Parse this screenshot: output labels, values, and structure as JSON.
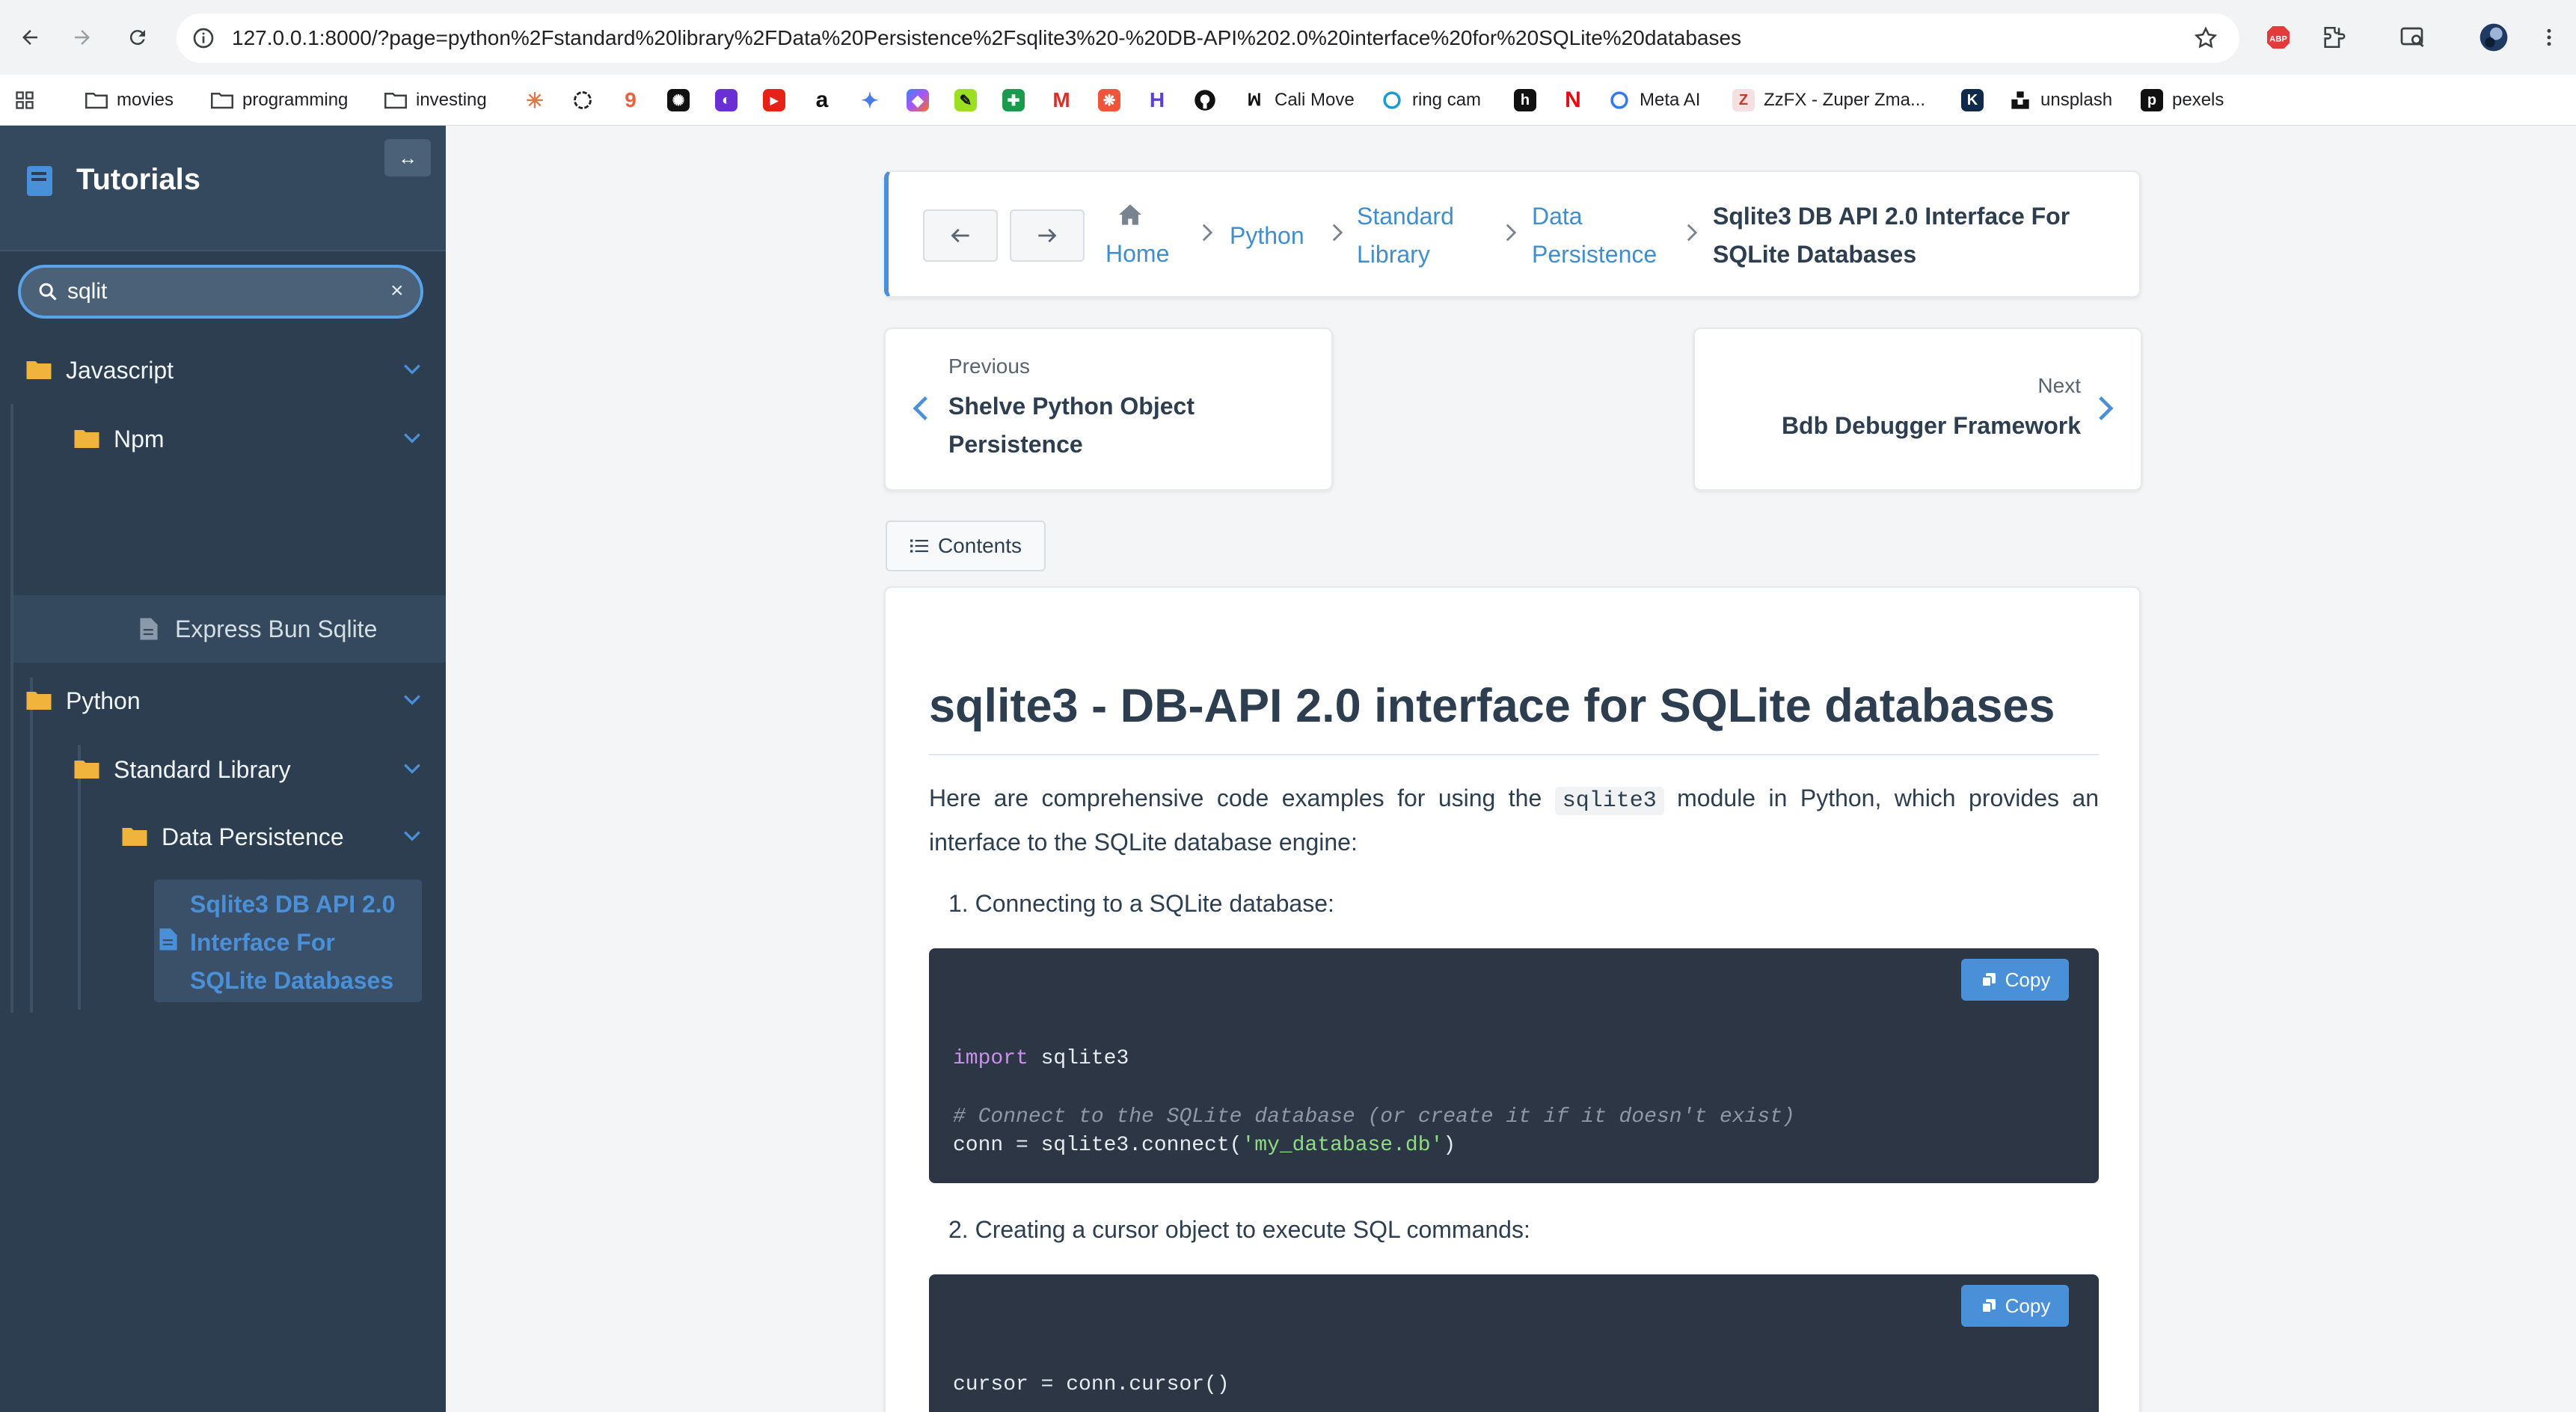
{
  "browser": {
    "url": "127.0.0.1:8000/?page=python%2Fstandard%20library%2FData%20Persistence%2Fsqlite3%20-%20DB-API%202.0%20interface%20for%20SQLite%20databases",
    "bookmarks": {
      "movies": "movies",
      "programming": "programming",
      "investing": "investing",
      "cali_move": "Cali Move",
      "ring_cam": "ring cam",
      "meta_ai": "Meta AI",
      "zzfx": "ZzFX - Zuper Zma...",
      "unsplash": "unsplash",
      "pexels": "pexels"
    }
  },
  "sidebar": {
    "title": "Tutorials",
    "toggle_label": "↔",
    "search": {
      "value": "sqlit",
      "clear": "×"
    },
    "tree": {
      "javascript": "Javascript",
      "npm": "Npm",
      "express": "Express Bun Sqlite",
      "python": "Python",
      "standard_library": "Standard Library",
      "data_persistence": "Data Persistence",
      "active_page": "Sqlite3 DB API 2.0 Interface For SQLite Databases"
    }
  },
  "breadcrumb": {
    "home": "Home",
    "python": "Python",
    "standard_library": "Standard Library",
    "data_persistence": "Data Persistence",
    "current": "Sqlite3 DB API 2.0 Interface For SQLite Databases"
  },
  "pager": {
    "previous_kicker": "Previous",
    "previous_title": "Shelve Python Object Persistence",
    "next_kicker": "Next",
    "next_title": "Bdb Debugger Framework"
  },
  "contents_label": "Contents",
  "article": {
    "title": "sqlite3 - DB-API 2.0 interface for SQLite databases",
    "intro_before": "Here are comprehensive code examples for using the ",
    "intro_code": "sqlite3",
    "intro_after": " module in Python, which provides an interface to the SQLite database engine:",
    "step1": "1. Connecting to a SQLite database:",
    "step2": "2. Creating a cursor object to execute SQL commands:",
    "copy_label": "Copy",
    "code1": {
      "import_kw": "import",
      "import_mod": " sqlite3",
      "comment": "# Connect to the SQLite database (or create it if it doesn't exist)",
      "conn_prefix": "conn = sqlite3.connect(",
      "conn_arg": "'my_database.db'",
      "conn_suffix": ")"
    },
    "code2": {
      "line1": "cursor = conn.cursor()"
    }
  },
  "colors": {
    "sidebar_bg": "#2c3e50",
    "accent": "#4a90d9",
    "code_bg": "#2c3644",
    "folder": "#f0b33c"
  }
}
